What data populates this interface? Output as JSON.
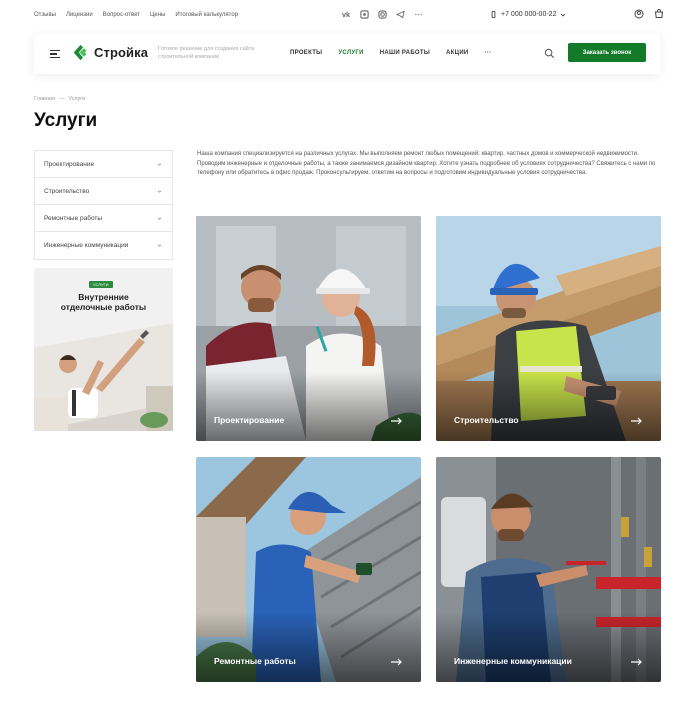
{
  "topbar": {
    "links": [
      "Отзывы",
      "Лицензии",
      "Вопрос-ответ",
      "Цены",
      "Итоговый калькулятор"
    ],
    "socials": [
      "vk-icon",
      "ok-icon",
      "instagram-icon",
      "telegram-icon",
      "more-icon"
    ],
    "phone": "+7 000 000-00-22"
  },
  "header": {
    "logo_text": "Стройка",
    "tagline": "Готовое решение для создания сайта строительной компании",
    "nav": [
      {
        "label": "ПРОЕКТЫ",
        "active": false
      },
      {
        "label": "УСЛУГИ",
        "active": true
      },
      {
        "label": "НАШИ РАБОТЫ",
        "active": false
      },
      {
        "label": "АКЦИИ",
        "active": false
      }
    ],
    "nav_more": "···",
    "cta_label": "Заказать звонок"
  },
  "breadcrumb": [
    "Главная",
    "—",
    "Услуги"
  ],
  "page_title": "Услуги",
  "sidebar": {
    "items": [
      {
        "label": "Проектирование"
      },
      {
        "label": "Строительство"
      },
      {
        "label": "Ремонтные работы"
      },
      {
        "label": "Инженерные коммуникации"
      }
    ]
  },
  "promo": {
    "badge": "УСЛУГИ",
    "title_line1": "Внутренние",
    "title_line2": "отделочные работы"
  },
  "description": "Наша компания специализируется на различных услугах. Мы выполняем ремонт любых помещений: квартир, частных домов и коммерческой недвижимости. Проводим инженерные и отделочные работы, а также занимаемся дизайном квартир. Хотите узнать подробнее об условиях сотрудничества? Свяжитесь с нами по телефону или обратитесь в офис продаж. Проконсультируем, ответим на вопросы и подготовим индивидуальные условия сотрудничества.",
  "cards": [
    {
      "label": "Проектирование"
    },
    {
      "label": "Строительство"
    },
    {
      "label": "Ремонтные работы"
    },
    {
      "label": "Инженерные коммуникации"
    }
  ],
  "colors": {
    "brand_green": "#127a28",
    "active_nav": "#1a7a2e"
  }
}
